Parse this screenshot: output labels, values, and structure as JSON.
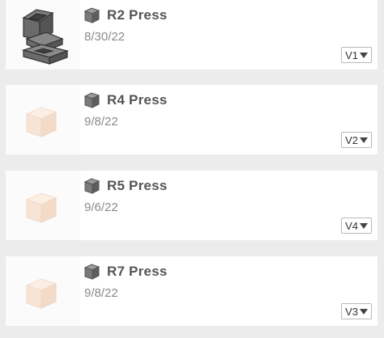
{
  "items": [
    {
      "title": "R2 Press",
      "date": "8/30/22",
      "version": "V1",
      "thumbnail": "part-model-thumbnail",
      "icon": "part-studio-icon"
    },
    {
      "title": "R4 Press",
      "date": "9/8/22",
      "version": "V2",
      "thumbnail": "placeholder-cube-thumbnail",
      "icon": "part-studio-icon"
    },
    {
      "title": "R5 Press",
      "date": "9/6/22",
      "version": "V4",
      "thumbnail": "placeholder-cube-thumbnail",
      "icon": "part-studio-icon"
    },
    {
      "title": "R7 Press",
      "date": "9/8/22",
      "version": "V3",
      "thumbnail": "placeholder-cube-thumbnail",
      "icon": "part-studio-icon"
    }
  ],
  "colors": {
    "background": "#ececec",
    "card": "#ffffff",
    "title": "#555555",
    "date": "#8a8a8a",
    "placeholder_cube": "#f6e3d4"
  }
}
